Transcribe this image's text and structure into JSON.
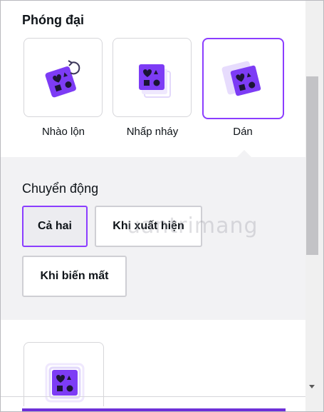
{
  "section": {
    "title": "Phóng đại"
  },
  "styles": [
    {
      "label": "Nhào lộn",
      "icon": "tumble-shapes-icon",
      "selected": false
    },
    {
      "label": "Nhấp nháy",
      "icon": "flicker-shapes-icon",
      "selected": false
    },
    {
      "label": "Dán",
      "icon": "stomp-shapes-icon",
      "selected": true
    }
  ],
  "motion": {
    "title": "Chuyển động",
    "options": [
      {
        "label": "Cả hai",
        "active": true
      },
      {
        "label": "Khi xuất hiện",
        "active": false
      },
      {
        "label": "Khi biến mất",
        "active": false
      }
    ]
  },
  "watermark": "uantrimang",
  "colors": {
    "accent": "#8b3dff",
    "icon": "#7d3cf5",
    "panel": "#f2f2f4"
  }
}
